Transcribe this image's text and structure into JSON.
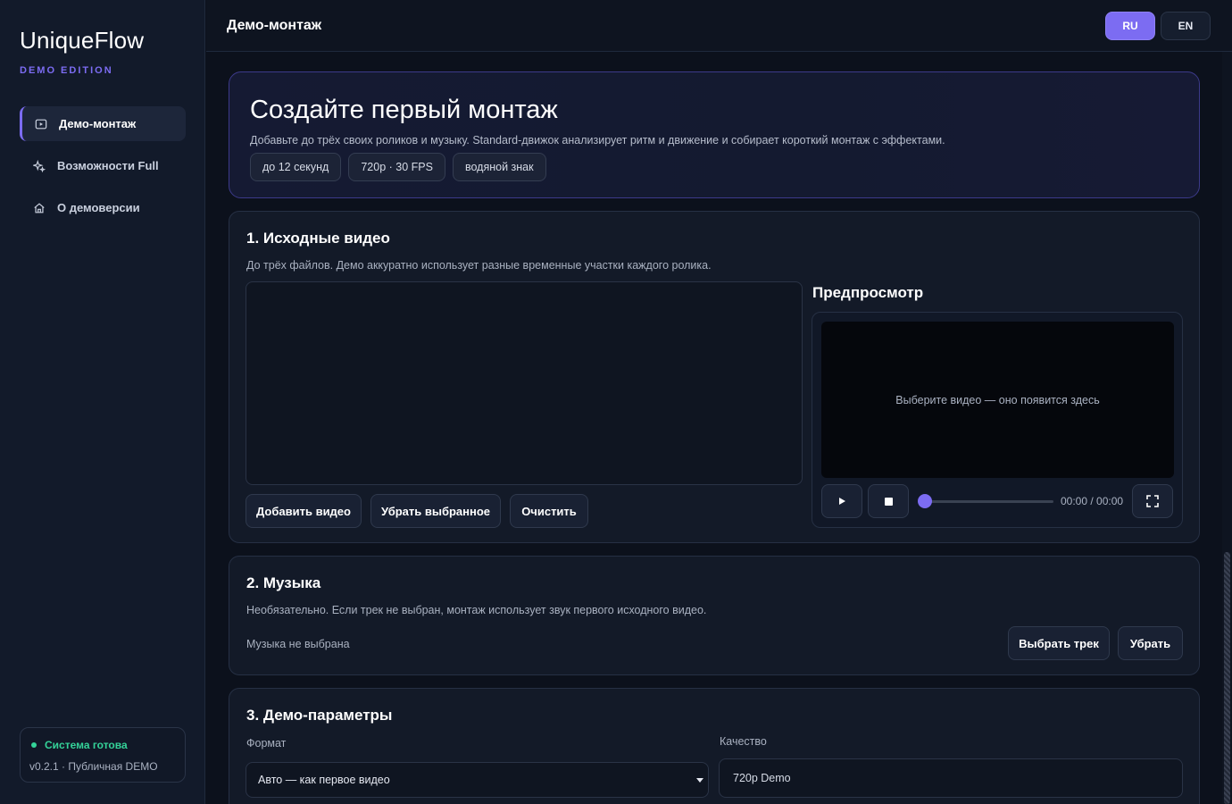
{
  "brand": {
    "name": "UniqueFlow",
    "edition": "DEMO EDITION"
  },
  "sidebar": {
    "items": [
      {
        "label": "Демо-монтаж",
        "icon": "video-icon",
        "active": true
      },
      {
        "label": "Возможности Full",
        "icon": "sparkles-icon",
        "active": false
      },
      {
        "label": "О демоверсии",
        "icon": "home-icon",
        "active": false
      }
    ],
    "status": {
      "text": "Система готова",
      "version": "v0.2.1 · Публичная DEMO",
      "color": "#34d399"
    }
  },
  "header": {
    "title": "Демо-монтаж",
    "lang_ru": "RU",
    "lang_en": "EN",
    "accent": "#7c6cf2"
  },
  "hero": {
    "title": "Создайте первый монтаж",
    "description": "Добавьте до трёх своих роликов и музыку. Standard-движок анализирует ритм и движение и собирает короткий монтаж с эффектами.",
    "chips": [
      "до 12 секунд",
      "720p · 30 FPS",
      "водяной знак"
    ]
  },
  "videos": {
    "title": "1. Исходные видео",
    "description": "До трёх файлов. Демо аккуратно использует разные временные участки каждого ролика.",
    "add_label": "Добавить видео",
    "remove_label": "Убрать выбранное",
    "clear_label": "Очистить",
    "preview_title": "Предпросмотр",
    "preview_placeholder": "Выберите видео — оно появится здесь",
    "time": "00:00 / 00:00",
    "progress": 0
  },
  "music": {
    "title": "2. Музыка",
    "description": "Необязательно. Если трек не выбран, монтаж использует звук первого исходного видео.",
    "status": "Музыка не выбрана",
    "choose_label": "Выбрать трек",
    "remove_label": "Убрать"
  },
  "params": {
    "title": "3. Демо-параметры",
    "format_label": "Формат",
    "format_value": "Авто — как первое видео",
    "quality_label": "Качество",
    "quality_value": "720p Demo"
  }
}
